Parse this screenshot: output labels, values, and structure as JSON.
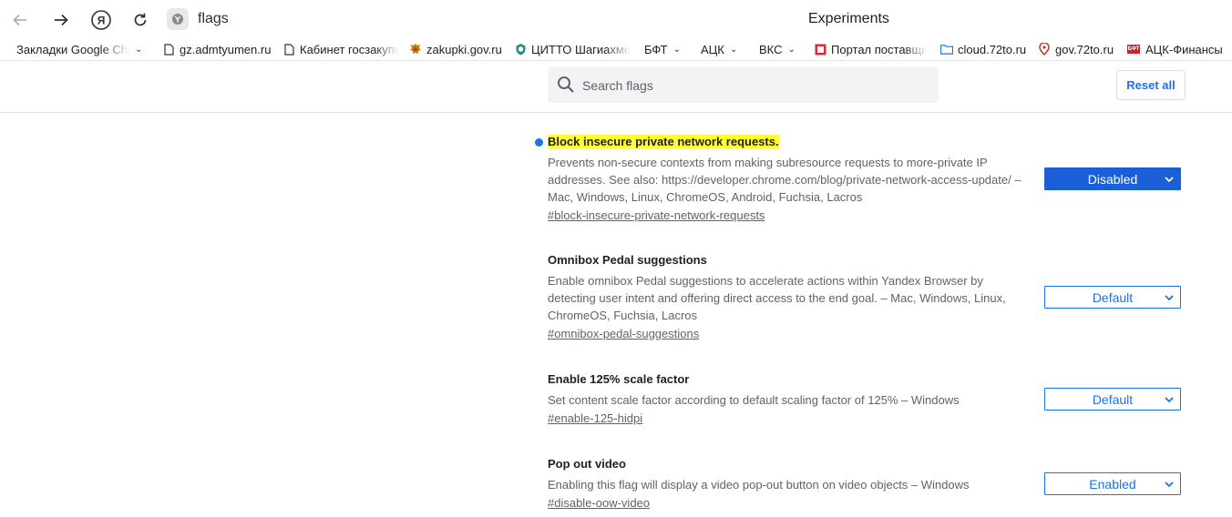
{
  "browser": {
    "address": "flags",
    "page_title": "Experiments"
  },
  "bookmarks": [
    {
      "label": "Закладки Google Chr",
      "icon": "none",
      "has_dropdown": true
    },
    {
      "label": "gz.admtyumen.ru",
      "icon": "page-icon"
    },
    {
      "label": "Кабинет госзакупо",
      "icon": "page-icon"
    },
    {
      "label": "zakupki.gov.ru",
      "icon": "emblem-icon"
    },
    {
      "label": "ЦИТТО Шагиахме",
      "icon": "shield-icon"
    },
    {
      "label": "БФТ",
      "icon": "none",
      "has_dropdown": true
    },
    {
      "label": "АЦК",
      "icon": "none",
      "has_dropdown": true
    },
    {
      "label": "ВКС",
      "icon": "none",
      "has_dropdown": true
    },
    {
      "label": "Портал поставщи",
      "icon": "portal-icon"
    },
    {
      "label": "cloud.72to.ru",
      "icon": "folder-icon"
    },
    {
      "label": "gov.72to.ru",
      "icon": "pin-icon"
    },
    {
      "label": "АЦК-Финансы",
      "icon": "bft-icon",
      "icon_text": "БФТ"
    }
  ],
  "header": {
    "search_placeholder": "Search flags",
    "reset_label": "Reset all"
  },
  "experiments": [
    {
      "title": "Block insecure private network requests.",
      "highlighted": true,
      "modified": true,
      "description": "Prevents non-secure contexts from making subresource requests to more-private IP addresses. See also: https://developer.chrome.com/blog/private-network-access-update/ – Mac, Windows, Linux, ChromeOS, Android, Fuchsia, Lacros",
      "link": "#block-insecure-private-network-requests",
      "value": "Disabled"
    },
    {
      "title": "Omnibox Pedal suggestions",
      "description": "Enable omnibox Pedal suggestions to accelerate actions within Yandex Browser by detecting user intent and offering direct access to the end goal. – Mac, Windows, Linux, ChromeOS, Fuchsia, Lacros",
      "link": "#omnibox-pedal-suggestions",
      "value": "Default"
    },
    {
      "title": "Enable 125% scale factor",
      "description": "Set content scale factor according to default scaling factor of 125% – Windows",
      "link": "#enable-125-hidpi",
      "value": "Default"
    },
    {
      "title": "Pop out video",
      "description": "Enabling this flag will display a video pop-out button on video objects – Windows",
      "link": "#disable-oow-video",
      "value": "Enabled"
    }
  ],
  "colors": {
    "accent": "#1a73e8",
    "active_select": "#1a5fd8",
    "highlight": "#ffff33"
  }
}
